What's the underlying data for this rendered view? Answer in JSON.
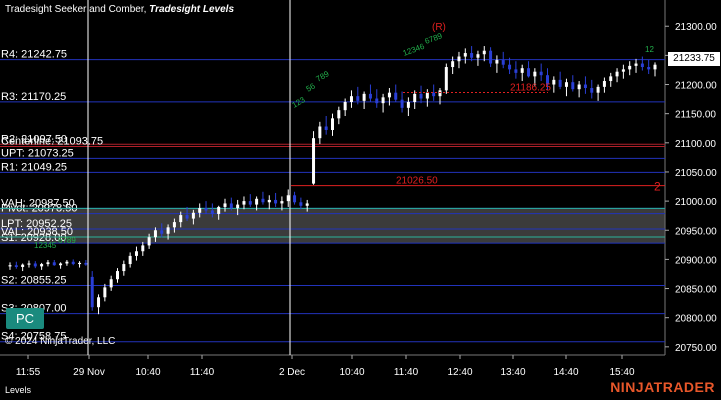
{
  "header": {
    "indicators": "Tradesight Seeker and Comber,",
    "levels_name": "Tradesight Levels"
  },
  "footer": {
    "copyright": "© 2024 NinjaTrader, LLC",
    "tab": "Levels",
    "brand": "NINJATRADER"
  },
  "pc_button": "PC",
  "last_price": "21233.75",
  "colors": {
    "background": "#000000",
    "candle_up": "#ffffff",
    "candle_down": "#2a3fd6",
    "level_blue": "#2233bb",
    "level_red": "#b0202a",
    "zone_fill": "#6b6b6b",
    "seeker_green": "#22b14c",
    "comber_red": "#e02020",
    "brand": "#e8572a"
  },
  "chart_data": {
    "type": "candlestick",
    "y_axis": {
      "ylim": [
        20736,
        21345
      ],
      "ticks": [
        21300,
        21250,
        21200,
        21150,
        21100,
        21050,
        21000,
        20950,
        20900,
        20850,
        20800,
        20750
      ],
      "tick_labels": [
        "21300.00",
        "21250.00",
        "21200.00",
        "21150.00",
        "21100.00",
        "21050.00",
        "21000.00",
        "20950.00",
        "20900.00",
        "20850.00",
        "20800.00",
        "20750.00"
      ]
    },
    "x_axis": {
      "tick_labels": [
        "11:55",
        "29 Nov",
        "10:40",
        "11:40",
        "2 Dec",
        "10:40",
        "11:40",
        "12:40",
        "13:40",
        "14:40",
        "15:40"
      ],
      "session_break_label": "2 Dec"
    },
    "levels": [
      {
        "label": "R4: 21242.75",
        "price": 21242.75,
        "color": "blue"
      },
      {
        "label": "R3: 21170.25",
        "price": 21170.25,
        "color": "blue"
      },
      {
        "label": "R2: 21097.50",
        "price": 21097.5,
        "color": "red"
      },
      {
        "label": "Centerline: 21093.75",
        "price": 21093.75,
        "color": "red"
      },
      {
        "label": "UPT: 21073.25",
        "price": 21073.25,
        "color": "blue"
      },
      {
        "label": "R1: 21049.25",
        "price": 21049.25,
        "color": "blue"
      },
      {
        "label": "VAH: 20987.50",
        "price": 20987.5,
        "color": "blue"
      },
      {
        "label": "Pivot: 20978.50",
        "price": 20978.5,
        "color": "blue"
      },
      {
        "label": "LPT: 20952.25",
        "price": 20952.25,
        "color": "blue"
      },
      {
        "label": "VAL: 20938.50",
        "price": 20938.5,
        "color": "blue"
      },
      {
        "label": "S1: 20928.00",
        "price": 20928.0,
        "color": "blue"
      },
      {
        "label": "S2: 20855.25",
        "price": 20855.25,
        "color": "blue"
      },
      {
        "label": "S3: 20807.00",
        "price": 20807.0,
        "color": "blue"
      },
      {
        "label": "S4: 20758.75",
        "price": 20758.75,
        "color": "blue"
      }
    ],
    "annotations": [
      {
        "text": "21026.50",
        "price": 21026.5,
        "color": "red"
      },
      {
        "text": "2",
        "color": "red"
      },
      {
        "text": "21186.25",
        "price": 21186.25,
        "color": "red"
      },
      {
        "text": "(R)",
        "color": "red"
      },
      {
        "text": "12345",
        "color": "green"
      },
      {
        "text": "6789",
        "color": "green"
      },
      {
        "text": "123",
        "color": "green"
      },
      {
        "text": "56",
        "color": "green"
      },
      {
        "text": "789",
        "color": "green"
      },
      {
        "text": "12346",
        "color": "green"
      },
      {
        "text": "6789",
        "color": "green"
      },
      {
        "text": "12",
        "color": "green"
      }
    ],
    "candles": [
      [
        20888,
        20895,
        20882,
        20890
      ],
      [
        20890,
        20896,
        20884,
        20887
      ],
      [
        20887,
        20893,
        20880,
        20891
      ],
      [
        20891,
        20898,
        20886,
        20893
      ],
      [
        20893,
        20897,
        20885,
        20888
      ],
      [
        20888,
        20894,
        20882,
        20892
      ],
      [
        20892,
        20899,
        20888,
        20895
      ],
      [
        20895,
        20899,
        20889,
        20890
      ],
      [
        20890,
        20895,
        20884,
        20893
      ],
      [
        20893,
        20899,
        20889,
        20896
      ],
      [
        20896,
        20900,
        20890,
        20892
      ],
      [
        20892,
        20897,
        20886,
        20894
      ],
      [
        20894,
        20899,
        20889,
        20891
      ],
      [
        20870,
        20880,
        20812,
        20818
      ],
      [
        20818,
        20840,
        20806,
        20835
      ],
      [
        20835,
        20858,
        20828,
        20852
      ],
      [
        20852,
        20872,
        20846,
        20866
      ],
      [
        20866,
        20885,
        20860,
        20880
      ],
      [
        20880,
        20898,
        20872,
        20892
      ],
      [
        20892,
        20912,
        20886,
        20906
      ],
      [
        20906,
        20922,
        20898,
        20914
      ],
      [
        20914,
        20930,
        20906,
        20924
      ],
      [
        20924,
        20944,
        20918,
        20938
      ],
      [
        20938,
        20955,
        20930,
        20950
      ],
      [
        20950,
        20962,
        20938,
        20944
      ],
      [
        20944,
        20960,
        20934,
        20955
      ],
      [
        20955,
        20970,
        20946,
        20964
      ],
      [
        20964,
        20982,
        20955,
        20976
      ],
      [
        20976,
        20990,
        20966,
        20970
      ],
      [
        20970,
        20985,
        20960,
        20980
      ],
      [
        20980,
        20996,
        20972,
        20988
      ],
      [
        20988,
        21000,
        20978,
        20984
      ],
      [
        20984,
        20996,
        20972,
        20978
      ],
      [
        20978,
        20992,
        20968,
        20990
      ],
      [
        20990,
        21004,
        20982,
        20996
      ],
      [
        20996,
        21006,
        20984,
        20988
      ],
      [
        20988,
        21002,
        20976,
        20994
      ],
      [
        20994,
        21008,
        20986,
        21000
      ],
      [
        21000,
        21012,
        20990,
        20994
      ],
      [
        20994,
        21008,
        20984,
        21004
      ],
      [
        21004,
        21016,
        20994,
        20998
      ],
      [
        20998,
        21010,
        20986,
        21002
      ],
      [
        21002,
        21014,
        20990,
        20996
      ],
      [
        20996,
        21008,
        20984,
        21000
      ],
      [
        21000,
        21020,
        20990,
        21010
      ],
      [
        21010,
        21016,
        20994,
        20998
      ],
      [
        20998,
        21006,
        20986,
        20992
      ],
      [
        20992,
        21002,
        20982,
        20996
      ],
      [
        21030,
        21120,
        21028,
        21108
      ],
      [
        21108,
        21136,
        21098,
        21128
      ],
      [
        21128,
        21146,
        21114,
        21122
      ],
      [
        21122,
        21150,
        21112,
        21142
      ],
      [
        21142,
        21162,
        21132,
        21156
      ],
      [
        21156,
        21176,
        21146,
        21170
      ],
      [
        21170,
        21190,
        21160,
        21180
      ],
      [
        21180,
        21196,
        21166,
        21172
      ],
      [
        21172,
        21188,
        21158,
        21184
      ],
      [
        21184,
        21200,
        21170,
        21176
      ],
      [
        21176,
        21192,
        21160,
        21168
      ],
      [
        21168,
        21184,
        21152,
        21178
      ],
      [
        21178,
        21194,
        21164,
        21186
      ],
      [
        21186,
        21200,
        21170,
        21174
      ],
      [
        21174,
        21188,
        21152,
        21160
      ],
      [
        21160,
        21178,
        21146,
        21170
      ],
      [
        21170,
        21190,
        21158,
        21184
      ],
      [
        21184,
        21198,
        21168,
        21176
      ],
      [
        21176,
        21192,
        21162,
        21186
      ],
      [
        21186,
        21200,
        21172,
        21180
      ],
      [
        21180,
        21194,
        21166,
        21190
      ],
      [
        21190,
        21236,
        21184,
        21230
      ],
      [
        21230,
        21248,
        21218,
        21240
      ],
      [
        21240,
        21256,
        21228,
        21248
      ],
      [
        21248,
        21262,
        21236,
        21254
      ],
      [
        21254,
        21266,
        21240,
        21246
      ],
      [
        21246,
        21258,
        21232,
        21252
      ],
      [
        21252,
        21266,
        21240,
        21258
      ],
      [
        21258,
        21264,
        21230,
        21236
      ],
      [
        21236,
        21250,
        21220,
        21242
      ],
      [
        21242,
        21256,
        21228,
        21234
      ],
      [
        21234,
        21246,
        21218,
        21226
      ],
      [
        21226,
        21240,
        21210,
        21220
      ],
      [
        21220,
        21234,
        21206,
        21228
      ],
      [
        21228,
        21240,
        21212,
        21214
      ],
      [
        21214,
        21228,
        21198,
        21222
      ],
      [
        21222,
        21236,
        21206,
        21216
      ],
      [
        21216,
        21228,
        21190,
        21200
      ],
      [
        21200,
        21214,
        21186,
        21208
      ],
      [
        21208,
        21222,
        21192,
        21196
      ],
      [
        21196,
        21210,
        21180,
        21204
      ],
      [
        21204,
        21216,
        21188,
        21192
      ],
      [
        21192,
        21206,
        21178,
        21200
      ],
      [
        21200,
        21214,
        21184,
        21194
      ],
      [
        21194,
        21208,
        21176,
        21186
      ],
      [
        21186,
        21200,
        21172,
        21196
      ],
      [
        21196,
        21212,
        21186,
        21206
      ],
      [
        21206,
        21220,
        21196,
        21214
      ],
      [
        21214,
        21228,
        21204,
        21222
      ],
      [
        21222,
        21234,
        21210,
        21226
      ],
      [
        21226,
        21240,
        21216,
        21232
      ],
      [
        21232,
        21244,
        21220,
        21236
      ],
      [
        21236,
        21248,
        21224,
        21230
      ],
      [
        21230,
        21242,
        21218,
        21226
      ],
      [
        21226,
        21238,
        21214,
        21234
      ]
    ]
  }
}
